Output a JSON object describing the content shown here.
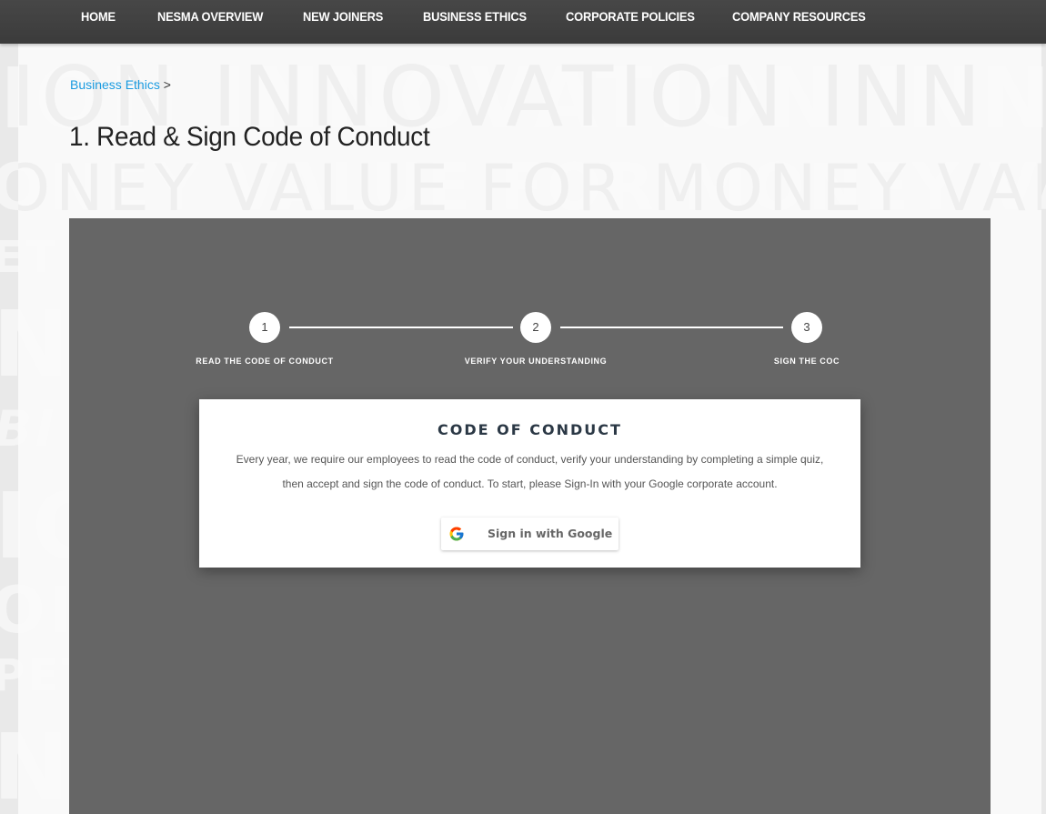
{
  "nav": {
    "items": [
      {
        "label": "HOME"
      },
      {
        "label": "NESMA OVERVIEW"
      },
      {
        "label": "NEW JOINERS"
      },
      {
        "label": "BUSINESS ETHICS"
      },
      {
        "label": "CORPORATE POLICIES"
      },
      {
        "label": "COMPANY RESOURCES"
      }
    ]
  },
  "background_watermark": {
    "lines": [
      "ION INNOVATION INN",
      "ONEY VALUE FOR MONEY VALU",
      "ET",
      "NC",
      "BI",
      "IO",
      "OI",
      "PET",
      "NO"
    ]
  },
  "breadcrumb": {
    "link": "Business Ethics",
    "separator": ">"
  },
  "page": {
    "title": "1. Read & Sign Code of Conduct"
  },
  "steps": [
    {
      "number": "1",
      "label": "READ THE CODE OF CONDUCT"
    },
    {
      "number": "2",
      "label": "VERIFY YOUR UNDERSTANDING"
    },
    {
      "number": "3",
      "label": "SIGN THE COC"
    }
  ],
  "coc": {
    "title": "CODE OF CONDUCT",
    "description": "Every year, we require our employees to read the code of conduct, verify your understanding by completing a simple quiz, then accept and sign the code of conduct. To start, please Sign-In with your Google corporate account.",
    "signin_label": "Sign in with Google"
  },
  "colors": {
    "nav_bg": "#404040",
    "link": "#1a9be0",
    "panel_bg": "#666666",
    "coc_title": "#2b3845"
  },
  "icons": {
    "google": "google-g-logo"
  }
}
